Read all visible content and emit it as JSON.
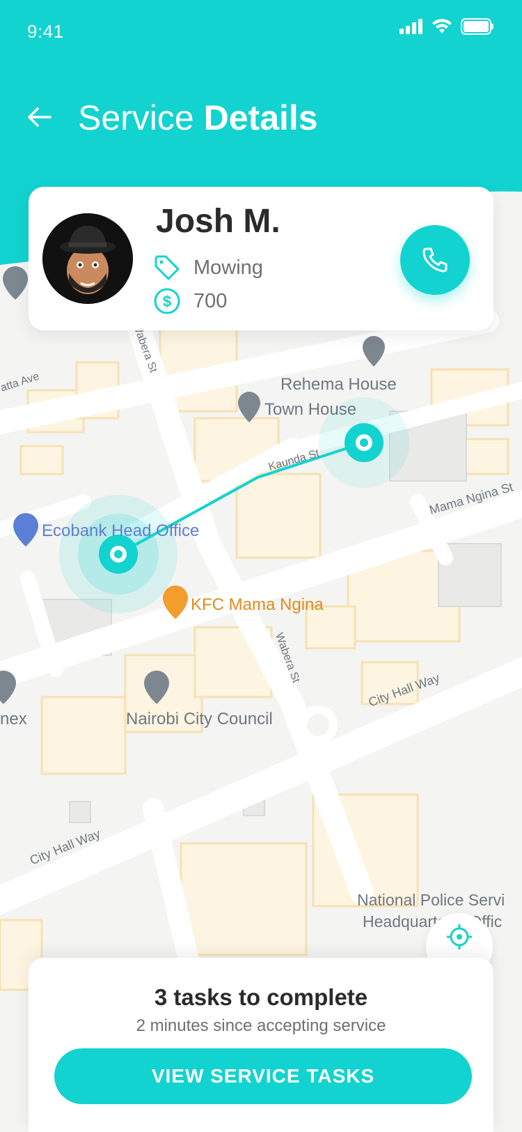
{
  "status_bar": {
    "time": "9:41"
  },
  "header": {
    "title_prefix": "Service",
    "title_bold": "Details",
    "accent": "#12d3cf"
  },
  "provider": {
    "name": "Josh M.",
    "service": "Mowing",
    "price": "700"
  },
  "map": {
    "labels": {
      "rehema": "Rehema House",
      "town_house": "Town House",
      "kaunda": "Kaunda St",
      "mama_ngina": "Mama Ngina St",
      "ecobank": "Ecobank Head Office",
      "kfc": "KFC Mama Ngina",
      "wabera1": "Wabera St",
      "wabera2": "Wabera St",
      "city_hall_way1": "City Hall Way",
      "city_hall_way2": "City Hall Way",
      "nairobi_council": "Nairobi City Council",
      "police_1": "National Police Servi",
      "police_2": "Headquarters (Offic",
      "annex": "nex",
      "latta": "atta Ave"
    }
  },
  "tasks": {
    "title": "3 tasks to complete",
    "subtitle": "2 minutes since accepting service",
    "button_label": "VIEW SERVICE TASKS"
  },
  "icons": {
    "back": "arrow-left-icon",
    "call": "phone-icon",
    "service": "tag-icon",
    "price": "dollar-icon",
    "locate": "locate-icon"
  }
}
